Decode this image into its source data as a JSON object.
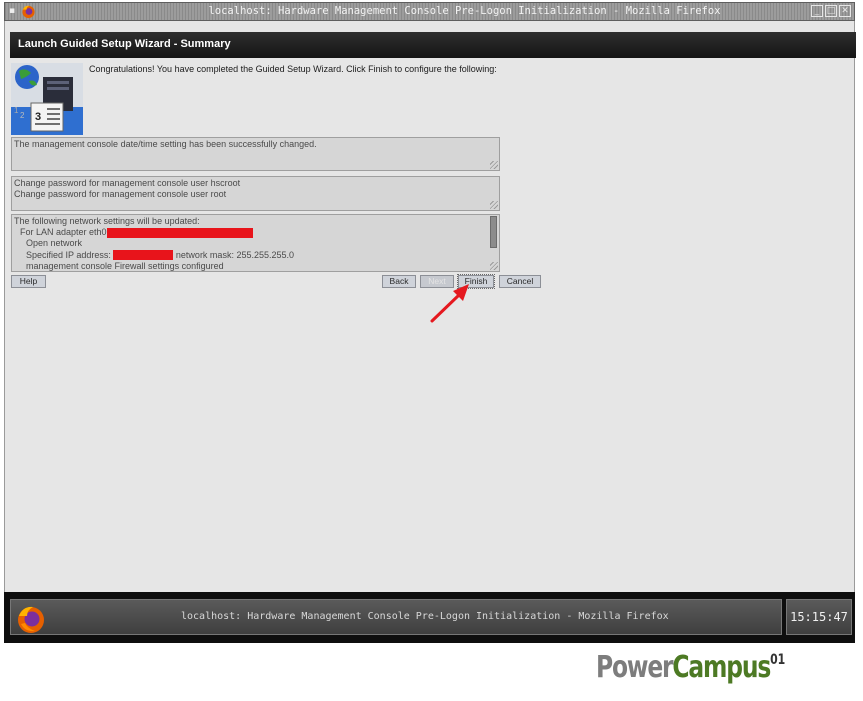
{
  "window": {
    "title": "localhost: Hardware Management Console Pre-Logon Initialization - Mozilla Firefox",
    "menu_glyph": "▪",
    "minimize_glyph": "_",
    "maximize_glyph": "□",
    "close_glyph": "✕"
  },
  "wizard": {
    "header": "Launch Guided Setup Wizard - Summary",
    "intro": "Congratulations! You have completed the Guided Setup Wizard. Click Finish to configure the following:",
    "datetime_summary": "The management console date/time setting has been successfully changed.",
    "password_summary": [
      "Change password for management console user hscroot",
      "Change password for management console user root"
    ],
    "network_summary": {
      "line1": "The following network settings will be updated:",
      "line2": "For LAN adapter eth0",
      "line3": "Open network",
      "line4a": "Specified IP address:",
      "line4b": "network mask: 255.255.255.0",
      "line5": "management console Firewall settings configured"
    },
    "buttons": {
      "help": "Help",
      "back": "Back",
      "next": "Next",
      "finish": "Finish",
      "cancel": "Cancel"
    },
    "redaction_color": "#e8141b",
    "arrow_color": "#e5191f"
  },
  "taskbar": {
    "task_title": "localhost: Hardware Management Console Pre-Logon Initialization - Mozilla Firefox",
    "clock": "15:15:47"
  },
  "watermark": {
    "part1": "Power",
    "part2": "Campus",
    "sup": "01"
  },
  "icons": {
    "wizard": "globe-server-document-icon",
    "app": "firefox-icon"
  }
}
